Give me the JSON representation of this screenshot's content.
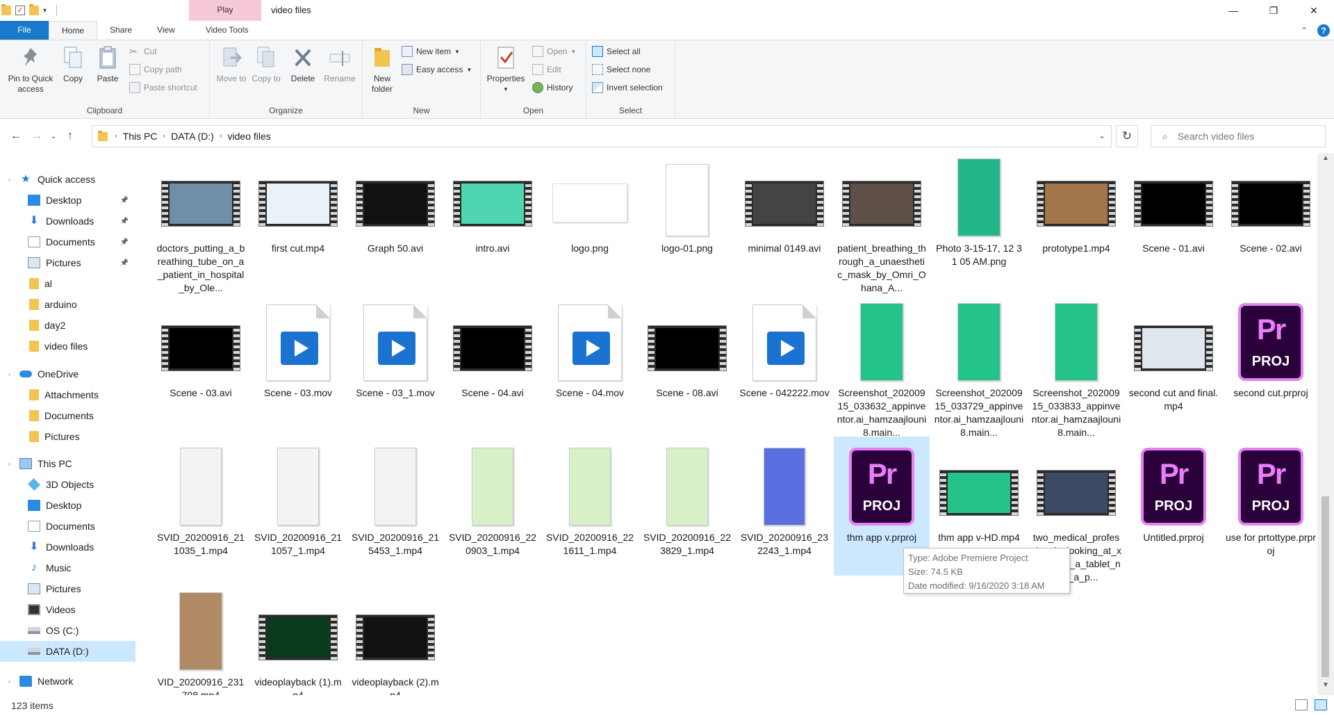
{
  "window": {
    "title": "video files",
    "contextual_tab": "Play",
    "minimize": "—",
    "restore": "❐",
    "close": "✕"
  },
  "ribbon_tabs": [
    {
      "label": "File"
    },
    {
      "label": "Home"
    },
    {
      "label": "Share"
    },
    {
      "label": "View"
    },
    {
      "label": "Video Tools"
    }
  ],
  "ribbon": {
    "clipboard": {
      "label": "Clipboard",
      "pin": "Pin to Quick access",
      "copy": "Copy",
      "paste": "Paste",
      "cut": "Cut",
      "copy_path": "Copy path",
      "paste_shortcut": "Paste shortcut"
    },
    "organize": {
      "label": "Organize",
      "move_to": "Move to",
      "copy_to": "Copy to",
      "delete": "Delete",
      "rename": "Rename"
    },
    "new": {
      "label": "New",
      "new_folder": "New folder",
      "new_item": "New item",
      "easy_access": "Easy access"
    },
    "open": {
      "label": "Open",
      "properties": "Properties",
      "open": "Open",
      "edit": "Edit",
      "history": "History"
    },
    "select": {
      "label": "Select",
      "select_all": "Select all",
      "select_none": "Select none",
      "invert": "Invert selection"
    }
  },
  "address": {
    "crumbs": [
      "This PC",
      "DATA (D:)",
      "video files"
    ],
    "search_placeholder": "Search video files"
  },
  "nav": {
    "quick_access": "Quick access",
    "quick_items": [
      "Desktop",
      "Downloads",
      "Documents",
      "Pictures",
      "al",
      "arduino",
      "day2",
      "video files"
    ],
    "onedrive": "OneDrive",
    "onedrive_items": [
      "Attachments",
      "Documents",
      "Pictures"
    ],
    "this_pc": "This PC",
    "pc_items": [
      "3D Objects",
      "Desktop",
      "Documents",
      "Downloads",
      "Music",
      "Pictures",
      "Videos",
      "OS (C:)",
      "DATA (D:)"
    ],
    "network": "Network"
  },
  "files": [
    {
      "name": "doctors_putting_a_breathing_tube_on_a_patient_in_hospital_by_Ole...",
      "kind": "video",
      "color": "#6f8fa8"
    },
    {
      "name": "first cut.mp4",
      "kind": "video",
      "color": "#e8f2f8"
    },
    {
      "name": "Graph 50.avi",
      "kind": "video",
      "color": "#111111"
    },
    {
      "name": "intro.avi",
      "kind": "video",
      "color": "#4fd6b0"
    },
    {
      "name": "logo.png",
      "kind": "png-wide"
    },
    {
      "name": "logo-01.png",
      "kind": "page"
    },
    {
      "name": "minimal 0149.avi",
      "kind": "video",
      "color": "#444444"
    },
    {
      "name": "patient_breathing_through_a_unaesthetic_mask_by_Omri_Ohana_A...",
      "kind": "video",
      "color": "#5e5048"
    },
    {
      "name": "Photo 3-15-17, 12 31 05 AM.png",
      "kind": "phone",
      "color": "#22b58a"
    },
    {
      "name": "prototype1.mp4",
      "kind": "video",
      "color": "#a0764a"
    },
    {
      "name": "Scene - 01.avi",
      "kind": "video",
      "color": "#000000"
    },
    {
      "name": "Scene - 02.avi",
      "kind": "video",
      "color": "#000000"
    },
    {
      "name": "Scene - 03.avi",
      "kind": "video",
      "color": "#000000"
    },
    {
      "name": "Scene - 03.mov",
      "kind": "mov"
    },
    {
      "name": "Scene - 03_1.mov",
      "kind": "mov"
    },
    {
      "name": "Scene - 04.avi",
      "kind": "video",
      "color": "#000000"
    },
    {
      "name": "Scene - 04.mov",
      "kind": "mov"
    },
    {
      "name": "Scene - 08.avi",
      "kind": "video",
      "color": "#000000"
    },
    {
      "name": "Scene - 042222.mov",
      "kind": "mov"
    },
    {
      "name": "Screenshot_20200915_033632_appinventor.ai_hamzaajlouni8.main...",
      "kind": "phone",
      "color": "#23c389"
    },
    {
      "name": "Screenshot_20200915_033729_appinventor.ai_hamzaajlouni8.main...",
      "kind": "phone",
      "color": "#23c389"
    },
    {
      "name": "Screenshot_20200915_033833_appinventor.ai_hamzaajlouni8.main...",
      "kind": "phone",
      "color": "#23c389"
    },
    {
      "name": "second cut and final.mp4",
      "kind": "video",
      "color": "#dfe6ec"
    },
    {
      "name": "second cut.prproj",
      "kind": "proj"
    },
    {
      "name": "SVID_20200916_211035_1.mp4",
      "kind": "phone",
      "color": "#f3f3f3"
    },
    {
      "name": "SVID_20200916_211057_1.mp4",
      "kind": "phone",
      "color": "#f3f3f3"
    },
    {
      "name": "SVID_20200916_215453_1.mp4",
      "kind": "phone",
      "color": "#f3f3f3"
    },
    {
      "name": "SVID_20200916_220903_1.mp4",
      "kind": "phone",
      "color": "#d8f0c8"
    },
    {
      "name": "SVID_20200916_221611_1.mp4",
      "kind": "phone",
      "color": "#d8f0c8"
    },
    {
      "name": "SVID_20200916_223829_1.mp4",
      "kind": "phone",
      "color": "#d8f0c8"
    },
    {
      "name": "SVID_20200916_232243_1.mp4",
      "kind": "phone",
      "color": "#5a6fe0"
    },
    {
      "name": "thm app v.prproj",
      "kind": "proj",
      "selected": true
    },
    {
      "name": "thm app v-HD.mp4",
      "kind": "video",
      "color": "#23c389"
    },
    {
      "name": "two_medical_professionals_looking_at_x-rays_on_a_tablet_near_a_p...",
      "kind": "video",
      "color": "#3c4a63"
    },
    {
      "name": "Untitled.prproj",
      "kind": "proj"
    },
    {
      "name": "use for prtottype.prproj",
      "kind": "proj"
    },
    {
      "name": "VID_20200916_231708.mp4",
      "kind": "phone",
      "color": "#b08a64"
    },
    {
      "name": "videoplayback (1).mp4",
      "kind": "video",
      "color": "#0b3b1f"
    },
    {
      "name": "videoplayback (2).mp4",
      "kind": "video",
      "color": "#111111"
    }
  ],
  "tooltip": {
    "type": "Type: Adobe Premiere Project",
    "size": "Size: 74.5 KB",
    "modified": "Date modified: 9/16/2020 3:18 AM"
  },
  "status": {
    "items": "123 items"
  },
  "colors": {
    "accent": "#1979ca",
    "selection": "#cce8ff",
    "play_tab": "#f7c8d9",
    "premiere": "#e77ff7"
  }
}
